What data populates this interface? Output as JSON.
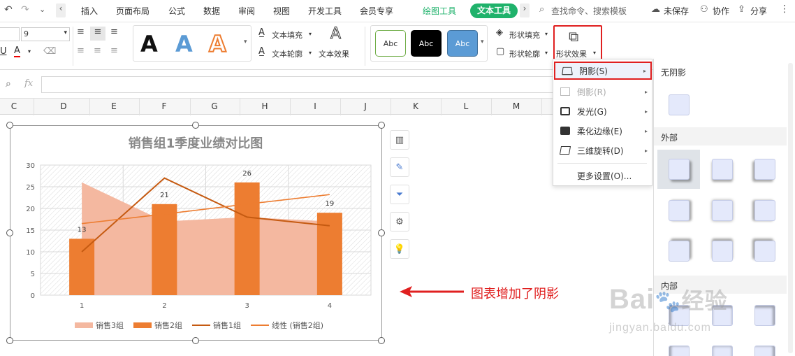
{
  "tabs": {
    "items": [
      "插入",
      "页面布局",
      "公式",
      "数据",
      "审阅",
      "视图",
      "开发工具",
      "会员专享"
    ],
    "drawing": "绘图工具",
    "text": "文本工具",
    "search": "查找命令、搜索模板",
    "unsaved": "未保存",
    "collab": "协作",
    "share": "分享"
  },
  "ribbon": {
    "font_size": "9",
    "text_fill": "文本填充",
    "text_outline": "文本轮廓",
    "text_effect": "文本效果",
    "shape_fill": "形状填充",
    "shape_outline": "形状轮廓",
    "shape_effect": "形状效果",
    "style_label": "Abc",
    "bigA": "A"
  },
  "formula": {
    "fx": "fx"
  },
  "columns": [
    "C",
    "D",
    "E",
    "F",
    "G",
    "H",
    "I",
    "J",
    "K",
    "L",
    "M"
  ],
  "menu": {
    "shadow": "阴影(S)",
    "reflection": "倒影(R)",
    "glow": "发光(G)",
    "soft_edges": "柔化边缘(E)",
    "rotation": "三维旋转(D)",
    "more": "更多设置(O)..."
  },
  "gallery": {
    "no_shadow": "无阴影",
    "outer": "外部",
    "inner": "内部"
  },
  "annotation": "图表增加了阴影",
  "watermark": {
    "brand": "Bai",
    "brand2": "经验",
    "url": "jingyan.baidu.com"
  },
  "colors": {
    "bar": "#ed7d31",
    "area": "#f4b8a0",
    "line": "#c55a11",
    "trend": "#ed7d31",
    "accent": "#1fb26b"
  },
  "chart_data": {
    "type": "bar",
    "title": "销售组1季度业绩对比图",
    "categories": [
      "1",
      "2",
      "3",
      "4"
    ],
    "ylim": [
      0,
      30
    ],
    "yticks": [
      "0",
      "5",
      "10",
      "15",
      "20",
      "25",
      "30"
    ],
    "series": [
      {
        "name": "销售3组",
        "type": "area",
        "values": [
          26,
          17,
          18,
          17
        ]
      },
      {
        "name": "销售2组",
        "type": "bar",
        "values": [
          13,
          21,
          26,
          19
        ]
      },
      {
        "name": "销售1组",
        "type": "line",
        "values": [
          10,
          27,
          18,
          16
        ]
      },
      {
        "name": "线性 (销售2组)",
        "type": "trend",
        "values": [
          16.5,
          18.7,
          21,
          23.2
        ]
      }
    ],
    "data_labels": [
      "13",
      "21",
      "26",
      "19"
    ],
    "legend_position": "bottom"
  }
}
